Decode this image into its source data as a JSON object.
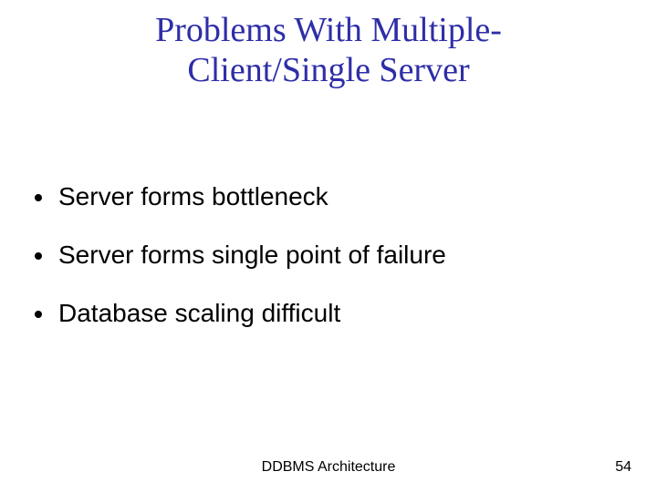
{
  "title": "Problems With Multiple-\nClient/Single Server",
  "bullets": [
    "Server forms bottleneck",
    "Server forms single point of failure",
    "Database scaling difficult"
  ],
  "footer": {
    "center": "DDBMS Architecture",
    "page": "54"
  }
}
